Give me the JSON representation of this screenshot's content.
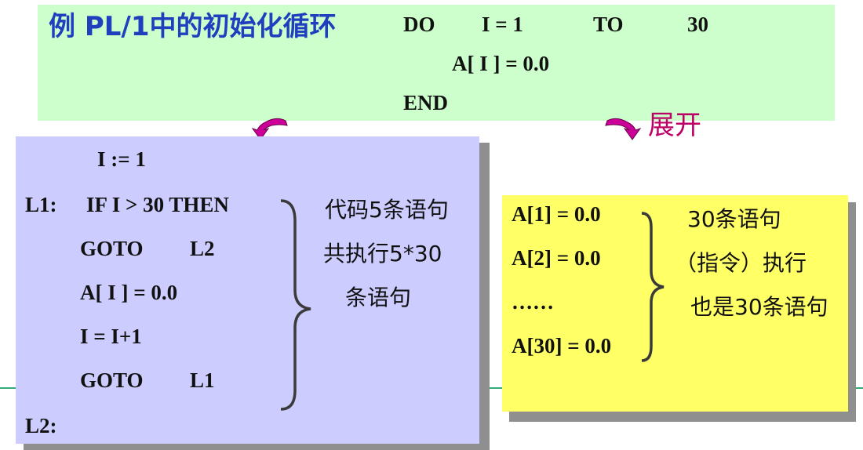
{
  "top": {
    "title": "例  PL/1中的初始化循环",
    "do_kw": "DO",
    "i_eq_1": "I = 1",
    "to_kw": "TO",
    "limit": "30",
    "assign": "A[ I ] = 0.0",
    "end_kw": "END"
  },
  "arrow_label": "展开",
  "left": {
    "lines": [
      "I := 1",
      "L1:",
      "IF  I > 30   THEN",
      "GOTO",
      "L2",
      "A[ I ] = 0.0",
      "I = I+1",
      "GOTO",
      "L1",
      "L2:"
    ],
    "note": [
      "代码5条语句",
      "共执行5*30",
      "条语句"
    ]
  },
  "right": {
    "lines": [
      "A[1] = 0.0",
      "A[2] = 0.0",
      "……",
      "A[30] = 0.0"
    ],
    "note": [
      "30条语句",
      "（指令）执行",
      "也是30条语句"
    ]
  },
  "colors": {
    "top_panel": "#ccffcc",
    "left_panel": "#ccccff",
    "right_panel": "#ffff66",
    "title": "#1f3fbf",
    "arrow": "#cc0099",
    "divider": "#33aa77"
  }
}
